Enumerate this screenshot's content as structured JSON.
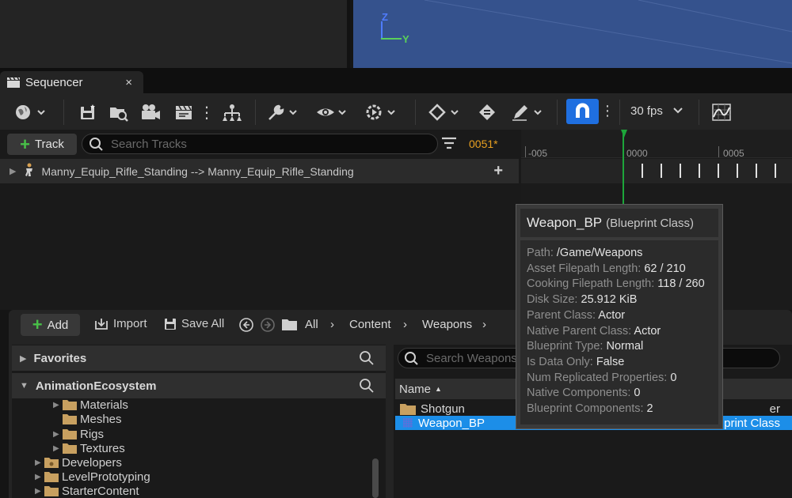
{
  "viewport": {
    "axis_z": "Z",
    "axis_y": "Y"
  },
  "tab": {
    "title": "Sequencer",
    "close": "×"
  },
  "toolbar": {
    "fps": "30 fps",
    "more": "⋮"
  },
  "sequencer": {
    "track_button": "Track",
    "search_placeholder": "Search Tracks",
    "current_frame": "0051*",
    "track_name": "Manny_Equip_Rifle_Standing --> Manny_Equip_Rifle_Standing",
    "ruler": [
      "-005",
      "0000",
      "0005"
    ]
  },
  "content_browser": {
    "add": "Add",
    "import": "Import",
    "save_all": "Save All",
    "breadcrumb": [
      "All",
      "Content",
      "Weapons"
    ],
    "favorites": "Favorites",
    "project": "AnimationEcosystem",
    "tree": [
      "Materials",
      "Meshes",
      "Rigs",
      "Textures",
      "Developers",
      "LevelPrototyping",
      "StarterContent"
    ],
    "search_placeholder": "Search Weapons",
    "column_name": "Name",
    "items": [
      {
        "name": "Shotgun",
        "type_suffix": "er"
      },
      {
        "name": "Weapon_BP",
        "type_suffix": "print Class"
      }
    ]
  },
  "tooltip": {
    "name": "Weapon_BP",
    "type": "(Blueprint Class)",
    "rows": [
      {
        "k": "Path:",
        "v": "/Game/Weapons"
      },
      {
        "k": "Asset Filepath Length:",
        "v": "62 / 210"
      },
      {
        "k": "Cooking Filepath Length:",
        "v": "118 / 260"
      },
      {
        "k": "Disk Size:",
        "v": "25.912 KiB"
      },
      {
        "k": "Parent Class:",
        "v": "Actor"
      },
      {
        "k": "Native Parent Class:",
        "v": "Actor"
      },
      {
        "k": "Blueprint Type:",
        "v": "Normal"
      },
      {
        "k": "Is Data Only:",
        "v": "False"
      },
      {
        "k": "Num Replicated Properties:",
        "v": "0"
      },
      {
        "k": "Native Components:",
        "v": "0"
      },
      {
        "k": "Blueprint Components:",
        "v": "2"
      }
    ]
  },
  "colors": {
    "accent": "#1f6fe0",
    "selection": "#1c8ee8",
    "frame": "#e8a020",
    "playhead": "#1da63a"
  }
}
